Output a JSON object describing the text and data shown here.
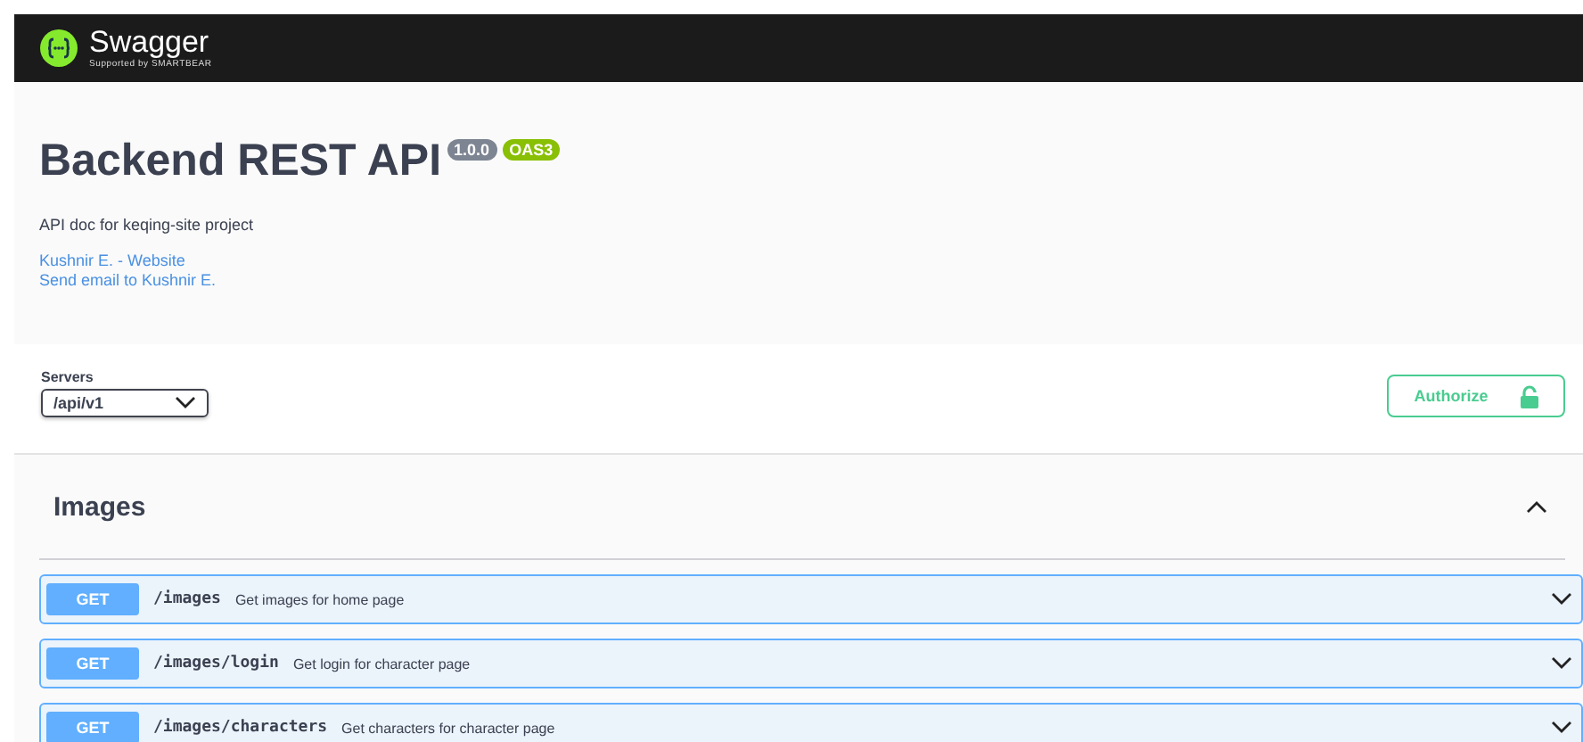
{
  "topbar": {
    "brand": "Swagger",
    "tagline": "Supported by SMARTBEAR"
  },
  "info": {
    "title": "Backend REST API",
    "version": "1.0.0",
    "spec": "OAS3",
    "description": "API doc for keqing-site project",
    "links": [
      "Kushnir E. - Website",
      "Send email to Kushnir E."
    ]
  },
  "servers": {
    "label": "Servers",
    "value": "/api/v1"
  },
  "authorize": {
    "label": "Authorize",
    "locked": false
  },
  "tags": [
    {
      "name": "Images",
      "expanded": true,
      "operations": [
        {
          "method": "GET",
          "path": "/images",
          "summary": "Get images for home page",
          "expanded": false
        },
        {
          "method": "GET",
          "path": "/images/login",
          "summary": "Get login for character page",
          "expanded": false
        },
        {
          "method": "GET",
          "path": "/images/characters",
          "summary": "Get characters for character page",
          "expanded": false
        }
      ]
    }
  ]
}
